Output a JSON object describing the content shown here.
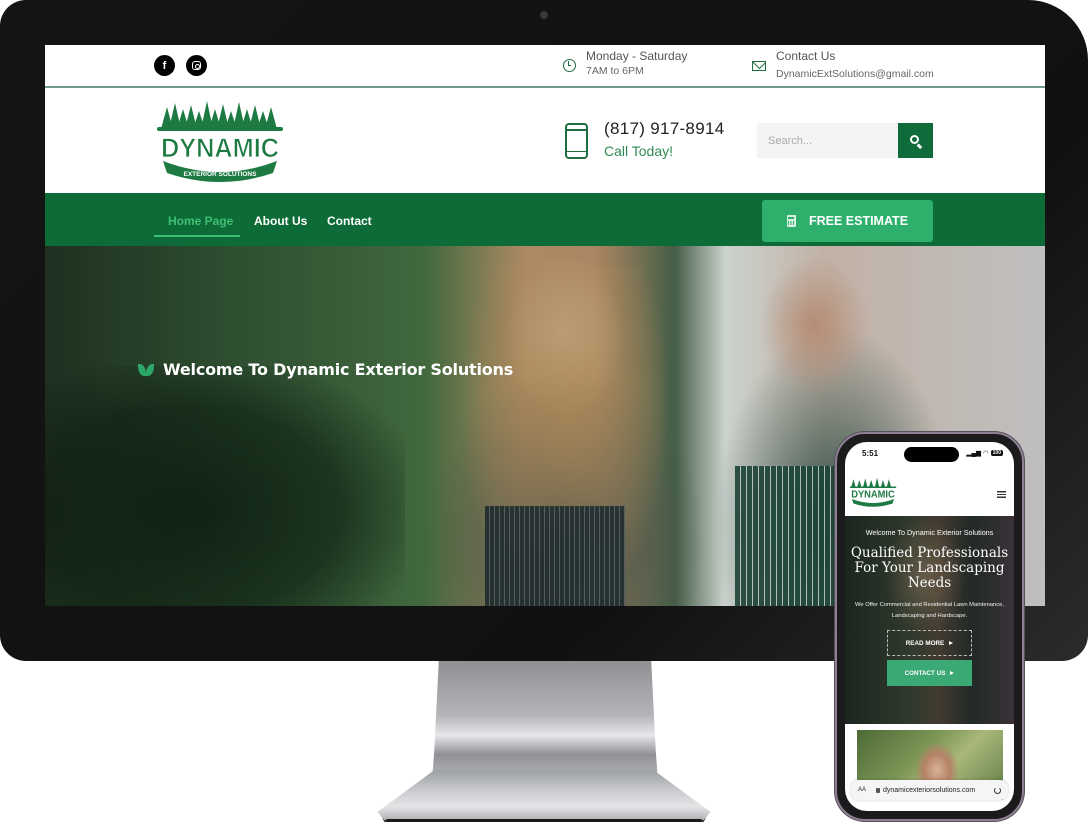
{
  "topbar": {
    "social": [
      {
        "name": "facebook",
        "icon": "facebook-icon",
        "glyph": "f"
      },
      {
        "name": "instagram",
        "icon": "instagram-icon"
      }
    ],
    "hours": {
      "icon": "clock-icon",
      "title": "Monday - Saturday",
      "subtitle": "7AM to 6PM"
    },
    "contact": {
      "icon": "mail-icon",
      "title": "Contact Us",
      "subtitle": "DynamicExtSolutions@gmail.com"
    }
  },
  "header": {
    "logo": {
      "main": "DYNAMIC",
      "tagline": "EXTERIOR SOLUTIONS"
    },
    "phone": {
      "icon": "smartphone-icon",
      "number": "(817) 917-8914",
      "cta": "Call Today!"
    },
    "search": {
      "placeholder": "Search...",
      "value": "",
      "button_icon": "search-icon"
    }
  },
  "nav": {
    "items": [
      {
        "label": "Home Page",
        "active": true
      },
      {
        "label": "About Us",
        "active": false
      },
      {
        "label": "Contact",
        "active": false
      }
    ],
    "cta": {
      "label": "FREE ESTIMATE",
      "icon": "calculator-icon"
    }
  },
  "hero": {
    "welcome": "Welcome To Dynamic Exterior Solutions",
    "icon": "leaf-icon"
  },
  "mobile": {
    "status": {
      "time": "5:51",
      "battery": "100"
    },
    "hero": {
      "welcome": "Welcome To Dynamic Exterior Solutions",
      "title": "Qualified Professionals For Your Landscaping Needs",
      "description": "We Offer Commercial and Residential Lawn Maintenance, Landscaping and Hardscape.",
      "read_more": "READ MORE",
      "contact_us": "CONTACT US"
    },
    "url_bar": {
      "aa": "AA",
      "url": "dynamicexteriorsolutions.com"
    }
  },
  "colors": {
    "brand_dark_green": "#0d6b38",
    "brand_accent_green": "#2eb06c",
    "active_nav": "#3fbf75",
    "text_green": "#2d8a52"
  }
}
